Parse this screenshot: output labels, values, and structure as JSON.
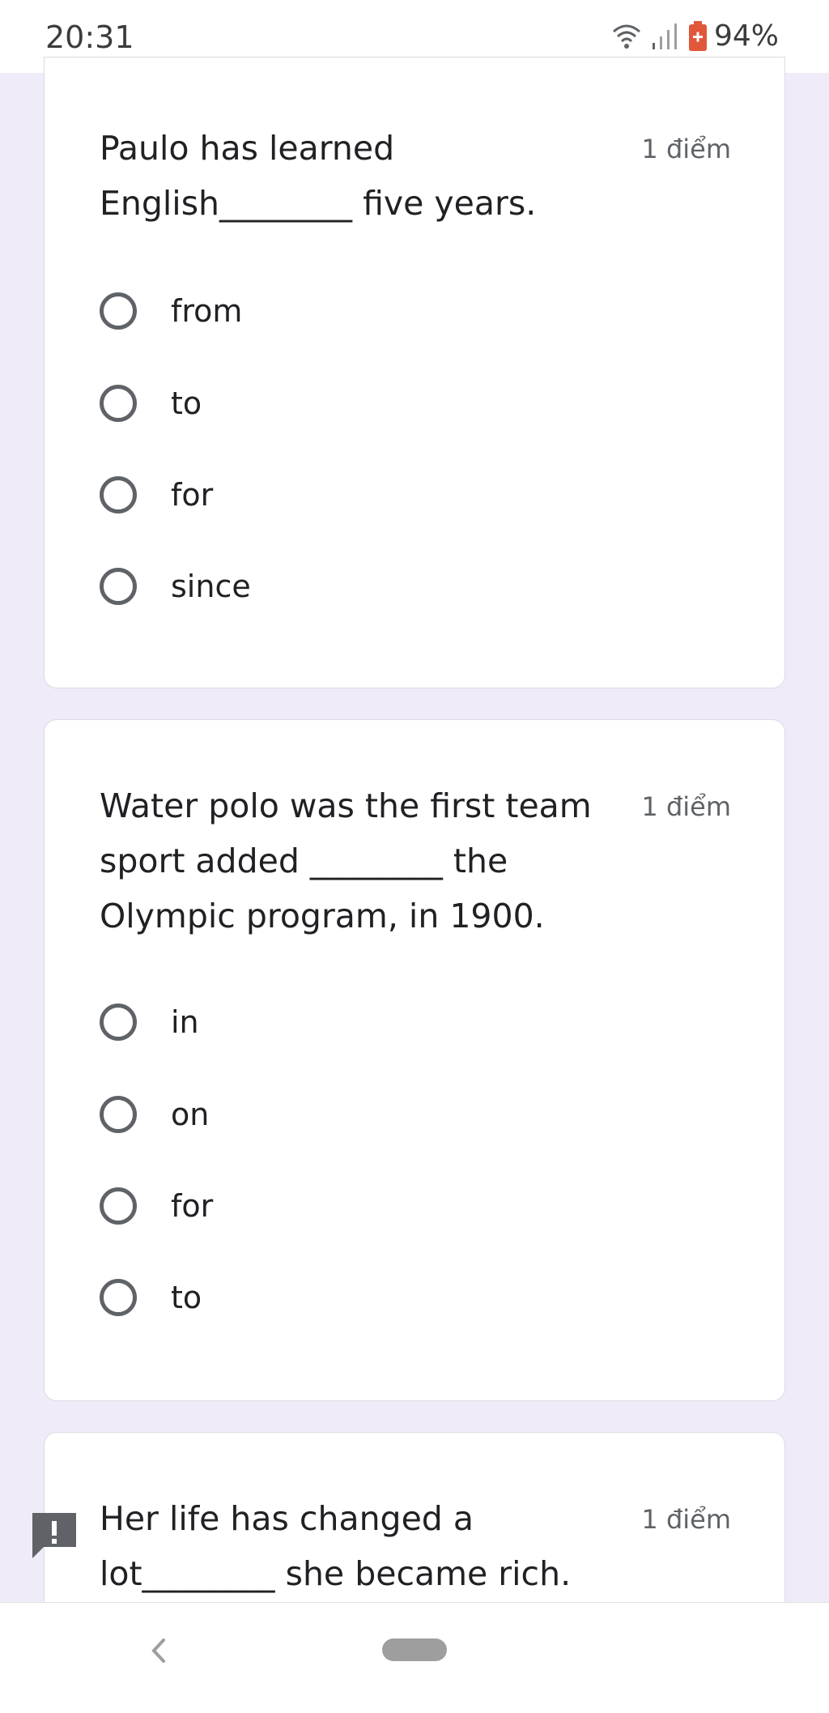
{
  "status_bar": {
    "time": "20:31",
    "battery": "94%",
    "icons": [
      "wifi-icon",
      "signal-icon",
      "battery-icon"
    ],
    "battery_color": "#e0573a"
  },
  "questions": [
    {
      "lines": [
        "Paulo has learned",
        "English________ five years."
      ],
      "points": "1 điểm",
      "options": [
        "from",
        "to",
        "for",
        "since"
      ]
    },
    {
      "lines": [
        "Water polo was the first team",
        "sport added ________ the",
        "Olympic program, in 1900."
      ],
      "points": "1 điểm",
      "options": [
        "in",
        "on",
        "for",
        "to"
      ]
    },
    {
      "lines": [
        "Her life has changed a",
        "lot________ she became rich."
      ],
      "points": "1 điểm",
      "options": []
    }
  ],
  "colors": {
    "background": "#f0ebf8",
    "card": "#ffffff",
    "text": "#202124",
    "muted": "#5f6368"
  },
  "icons": {
    "report": "report-problem-icon",
    "nav_back": "back-icon",
    "nav_home": "home-pill-icon"
  }
}
